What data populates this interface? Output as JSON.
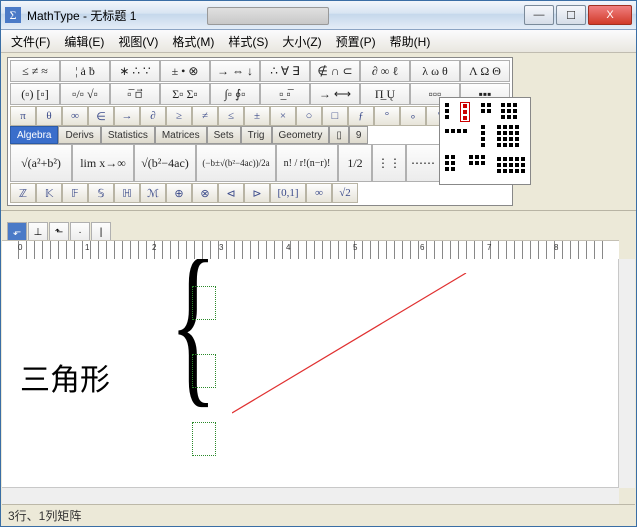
{
  "window": {
    "app_icon": "Σ",
    "title": "MathType - 无标题 1",
    "min": "—",
    "max": "☐",
    "close": "X"
  },
  "menu": {
    "file": "文件(F)",
    "edit": "编辑(E)",
    "view": "视图(V)",
    "format": "格式(M)",
    "style": "样式(S)",
    "size": "大小(Z)",
    "preset": "预置(P)",
    "help": "帮助(H)"
  },
  "palette_row1": {
    "c1": "≤ ≠ ≈",
    "c2": "¦ ȧ ḃ",
    "c3": "∗ ∴ ∵",
    "c4": "± • ⊗",
    "c5": "→ ⇔ ↓",
    "c6": "∴ ∀ ∃",
    "c7": "∉ ∩ ⊂",
    "c8": "∂ ∞ ℓ",
    "c9": "λ ω θ",
    "c10": "Λ Ω Θ"
  },
  "palette_row2": {
    "c1": "(▫) [▫]",
    "c2": "▫/▫ √▫",
    "c3": "▫̅  ▫⃗",
    "c4": "Σ▫ Σ▫",
    "c5": "∫▫ ∮▫",
    "c6": "▫̲  ▫̅",
    "c7": "→ ⟷",
    "c8": "Π̲  Ų",
    "c9": "▫▫▫",
    "c10": "▪▪▪"
  },
  "symbol_keys": {
    "k1": "π",
    "k2": "θ",
    "k3": "∞",
    "k4": "∈",
    "k5": "→",
    "k6": "∂",
    "k7": "≥",
    "k8": "≠",
    "k9": "≤",
    "k10": "±",
    "k11": "×",
    "k12": "○",
    "k13": "□",
    "k14": "ƒ",
    "k15": "°",
    "k16": "∘",
    "k17": "′",
    "k18": "″"
  },
  "tabs": {
    "t1": "Algebra",
    "t2": "Derivs",
    "t3": "Statistics",
    "t4": "Matrices",
    "t5": "Sets",
    "t6": "Trig",
    "t7": "Geometry",
    "t8": "▯",
    "t9": "9"
  },
  "templates": {
    "t1": "√(a²+b²)",
    "t2": "lim x→∞",
    "t3": "√(b²−4ac)",
    "t4": "(−b±√(b²−4ac))/2a",
    "t5": "n! / r!(n−r)!",
    "t6": "1/2",
    "t7": "⋮⋮",
    "t8": "⋯⋯"
  },
  "bottom_keys": {
    "k1": "ℤ",
    "k2": "𝕂",
    "k3": "𝔽",
    "k4": "𝕊",
    "k5": "ℍ",
    "k6": "ℳ",
    "k7": "⊕",
    "k8": "⊗",
    "k9": "⊲",
    "k10": "⊳",
    "k11": "[0,1]",
    "k12": "∞",
    "k13": "√2"
  },
  "ruler": {
    "n0": "0",
    "n1": "1",
    "n2": "2",
    "n3": "3",
    "n4": "4",
    "n5": "5",
    "n6": "6",
    "n7": "7",
    "n8": "8"
  },
  "document": {
    "text": "三角形"
  },
  "statusbar": {
    "text": "3行、1列矩阵"
  }
}
